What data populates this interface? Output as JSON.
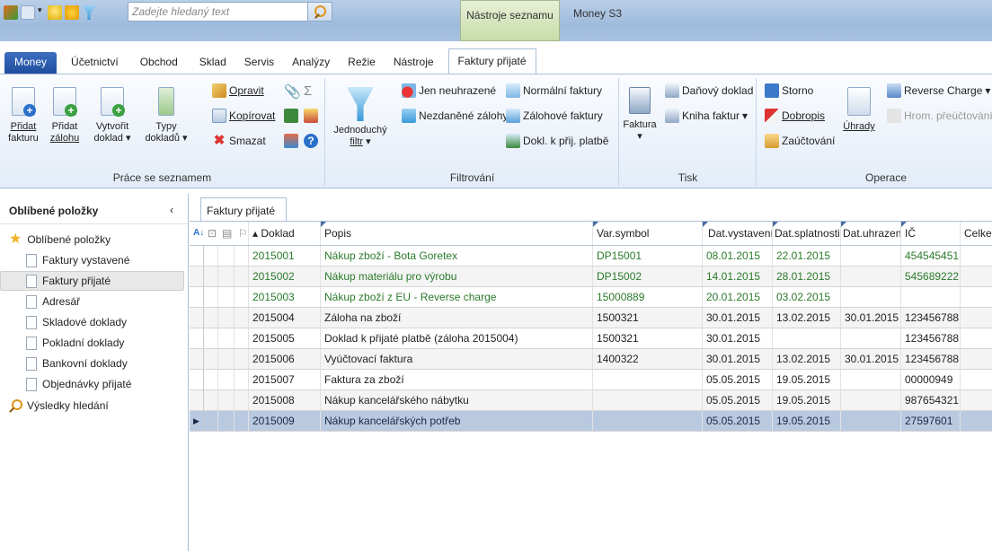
{
  "titlebar": {
    "search_placeholder": "Zadejte hledaný text",
    "context_tab": "Nástroje seznamu",
    "app_title": "Money S3"
  },
  "tabs": [
    "Money",
    "Účetnictví",
    "Obchod",
    "Sklad",
    "Servis",
    "Analýzy",
    "Režie",
    "Nástroje",
    "Faktury přijaté"
  ],
  "ribbon": {
    "groups": {
      "list": "Práce se seznamem",
      "filter": "Filtrování",
      "print": "Tisk",
      "ops": "Operace"
    },
    "list": {
      "add_invoice_1": "Přidat",
      "add_invoice_2": "fakturu",
      "add_advance_1": "Přidat",
      "add_advance_2": "zálohu",
      "create_doc_1": "Vytvořit",
      "create_doc_2": "doklad",
      "doc_types_1": "Typy",
      "doc_types_2": "dokladů",
      "edit": "Opravit",
      "copy": "Kopírovat",
      "delete": "Smazat"
    },
    "filter": {
      "simple_1": "Jednoduchý",
      "simple_2": "filtr",
      "unpaid": "Jen neuhrazené",
      "untaxed_adv": "Nezdaněné zálohy",
      "normal": "Normální faktury",
      "advance": "Zálohové faktury",
      "received_pay": "Dokl. k přij. platbě"
    },
    "print": {
      "invoice": "Faktura",
      "tax_doc": "Daňový doklad",
      "book": "Kniha faktur"
    },
    "ops": {
      "storno": "Storno",
      "credit": "Dobropis",
      "post": "Zaúčtování",
      "payments": "Úhrady",
      "reverse": "Reverse Charge",
      "bulk_recount": "Hrom. přeúčtování"
    }
  },
  "sidebar": {
    "title": "Oblíbené položky",
    "favorites": "Oblíbené položky",
    "items": [
      "Faktury vystavené",
      "Faktury přijaté",
      "Adresář",
      "Skladové doklady",
      "Pokladní doklady",
      "Bankovní doklady",
      "Objednávky přijaté"
    ],
    "search_results": "Výsledky hledání"
  },
  "grid": {
    "tab": "Faktury přijaté",
    "columns": {
      "doklad": "Doklad",
      "popis": "Popis",
      "var": "Var.symbol",
      "vyst": "Dat.vystavení",
      "splat": "Dat.splatnosti",
      "uhr": "Dat.uhrazení",
      "ic": "IČ",
      "celkem": "Celkem"
    },
    "rows": [
      {
        "doklad": "2015001",
        "popis": "Nákup zboží - Bota Goretex",
        "var": "DP15001",
        "vyst": "08.01.2015",
        "splat": "22.01.2015",
        "uhr": "",
        "ic": "454545451",
        "green": true
      },
      {
        "doklad": "2015002",
        "popis": "Nákup materiálu pro výrobu",
        "var": "DP15002",
        "vyst": "14.01.2015",
        "splat": "28.01.2015",
        "uhr": "",
        "ic": "545689222",
        "green": true
      },
      {
        "doklad": "2015003",
        "popis": "Nákup zboží z EU - Reverse charge",
        "var": "15000889",
        "vyst": "20.01.2015",
        "splat": "03.02.2015",
        "uhr": "",
        "ic": "",
        "green": true
      },
      {
        "doklad": "2015004",
        "popis": "Záloha na zboží",
        "var": "1500321",
        "vyst": "30.01.2015",
        "splat": "13.02.2015",
        "uhr": "30.01.2015",
        "ic": "123456788",
        "green": false
      },
      {
        "doklad": "2015005",
        "popis": "Doklad k přijaté platbě (záloha 2015004)",
        "var": "1500321",
        "vyst": "30.01.2015",
        "splat": "",
        "uhr": "",
        "ic": "123456788",
        "green": false
      },
      {
        "doklad": "2015006",
        "popis": "Vyúčtovací faktura",
        "var": "1400322",
        "vyst": "30.01.2015",
        "splat": "13.02.2015",
        "uhr": "30.01.2015",
        "ic": "123456788",
        "green": false
      },
      {
        "doklad": "2015007",
        "popis": "Faktura za zboží",
        "var": "",
        "vyst": "05.05.2015",
        "splat": "19.05.2015",
        "uhr": "",
        "ic": "00000949",
        "green": false
      },
      {
        "doklad": "2015008",
        "popis": "Nákup kancelářského nábytku",
        "var": "",
        "vyst": "05.05.2015",
        "splat": "19.05.2015",
        "uhr": "",
        "ic": "987654321",
        "green": false
      },
      {
        "doklad": "2015009",
        "popis": "Nákup kancelářských potřeb",
        "var": "",
        "vyst": "05.05.2015",
        "splat": "19.05.2015",
        "uhr": "",
        "ic": "27597601",
        "green": false
      }
    ]
  }
}
